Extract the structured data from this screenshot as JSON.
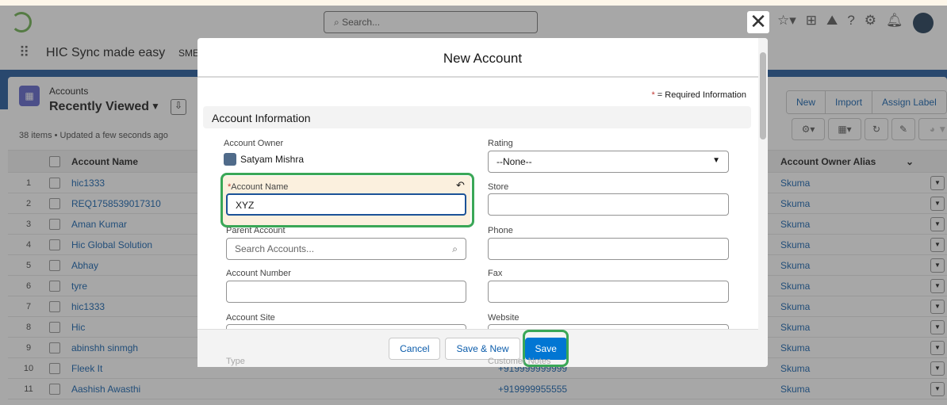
{
  "header": {
    "search_placeholder": "Search..."
  },
  "nav": {
    "app_name": "HIC Sync made easy",
    "tab": "SME"
  },
  "list": {
    "object": "Accounts",
    "view": "Recently Viewed",
    "status": "38 items • Updated a few seconds ago",
    "buttons": [
      "New",
      "Import",
      "Assign Label"
    ],
    "columns": {
      "name": "Account Name",
      "alias": "Account Owner Alias"
    },
    "rows": [
      {
        "n": "1",
        "name": "hic1333",
        "phone": "",
        "alias": "Skuma"
      },
      {
        "n": "2",
        "name": "REQ1758539017310",
        "phone": "",
        "alias": "Skuma"
      },
      {
        "n": "3",
        "name": "Aman Kumar",
        "phone": "",
        "alias": "Skuma"
      },
      {
        "n": "4",
        "name": "Hic Global Solution",
        "phone": "",
        "alias": "Skuma"
      },
      {
        "n": "5",
        "name": "Abhay",
        "phone": "",
        "alias": "Skuma"
      },
      {
        "n": "6",
        "name": "tyre",
        "phone": "",
        "alias": "Skuma"
      },
      {
        "n": "7",
        "name": "hic1333",
        "phone": "",
        "alias": "Skuma"
      },
      {
        "n": "8",
        "name": "Hic",
        "phone": "",
        "alias": "Skuma"
      },
      {
        "n": "9",
        "name": "abinshh sinmgh",
        "phone": "",
        "alias": "Skuma"
      },
      {
        "n": "10",
        "name": "Fleek It",
        "phone": "+919999999999",
        "alias": "Skuma"
      },
      {
        "n": "11",
        "name": "Aashish Awasthi",
        "phone": "+919999955555",
        "alias": "Skuma"
      }
    ]
  },
  "modal": {
    "title": "New Account",
    "required_note": "= Required Information",
    "section": "Account Information",
    "owner_label": "Account Owner",
    "owner": "Satyam Mishra",
    "rating_label": "Rating",
    "rating_value": "--None--",
    "name_label": "Account Name",
    "name_value": "XYZ",
    "store_label": "Store",
    "parent_label": "Parent Account",
    "parent_placeholder": "Search Accounts...",
    "phone_label": "Phone",
    "number_label": "Account Number",
    "fax_label": "Fax",
    "site_label": "Account Site",
    "website_label": "Website",
    "type_label": "Type",
    "notes_label": "Customer Notes",
    "cancel": "Cancel",
    "save_new": "Save & New",
    "save": "Save"
  }
}
